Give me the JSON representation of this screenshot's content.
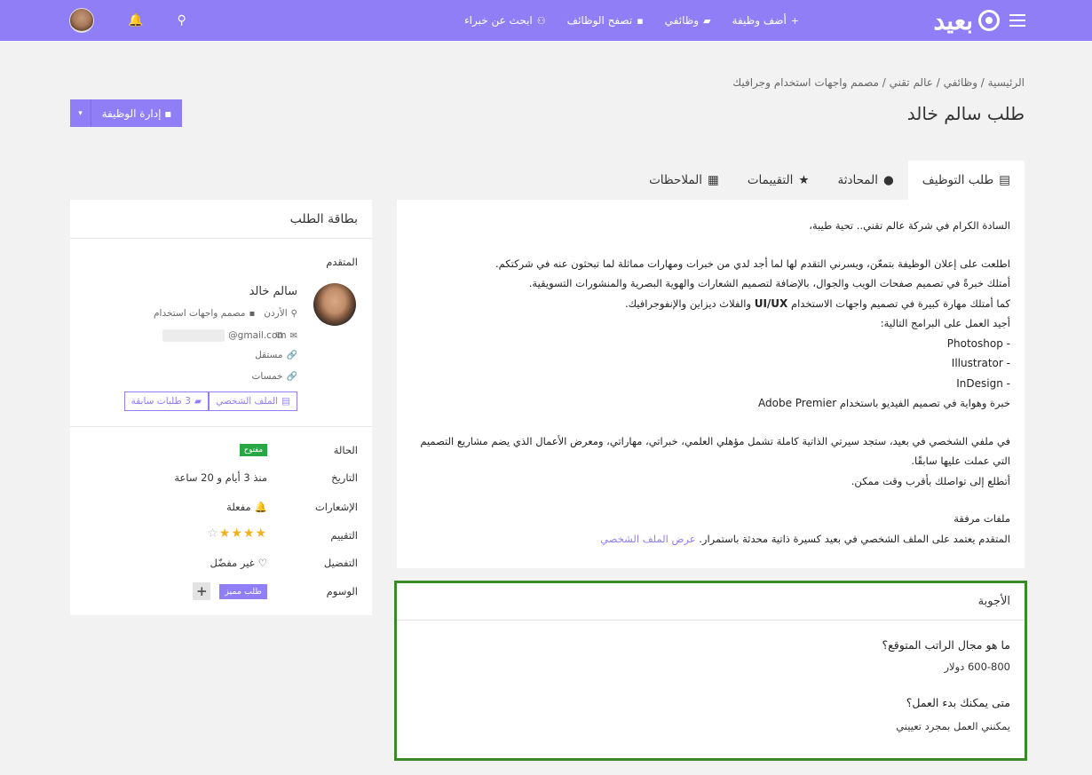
{
  "nav": {
    "logo": "بعيد",
    "links": [
      {
        "icon": "+",
        "label": "أضف وظيفة"
      },
      {
        "icon": "▰",
        "label": "وظائفي"
      },
      {
        "icon": "▪",
        "label": "تصفح الوظائف"
      },
      {
        "icon": "⚇",
        "label": "ابحث عن خبراء"
      }
    ]
  },
  "breadcrumb": "الرئيسية / وظائفي / عالم تقني / مصمم واجهات استخدام وجرافيك",
  "page_title": "طلب سالم خالد",
  "manage_button": "إدارة الوظيفة",
  "tabs": [
    {
      "label": "طلب التوظيف",
      "icon": "▤"
    },
    {
      "label": "المحادثة",
      "icon": "●"
    },
    {
      "label": "التقييمات",
      "icon": "★"
    },
    {
      "label": "الملاحظات",
      "icon": "▦"
    }
  ],
  "letter": {
    "greeting": "السادة الكرام في شركة عالم تقني.. تحية طيبة،",
    "p1": "اطلعت على إعلان الوظيفة بتمعّن، ويسرني التقدم لها لما أجد لدي من خبرات ومهارات مماثلة لما تبحثون عنه في شركتكم.",
    "p2": "أمتلك خبرةً في تصميم صفحات الويب والجوال، بالإضافة لتصميم الشعارات والهوية البصرية والمنشورات التسويقية.",
    "p3_a": "كما أمتلك مهارة كبيرة في تصميم واجهات الاستخدام",
    "p3_b": "UI/UX",
    "p3_c": "والفلاث ديزاين والإنفوجرافيك.",
    "p4": "أجيد العمل على البرامج التالية:",
    "prog1": "- Photoshop",
    "prog2": "- Illustrator",
    "prog3": "- InDesign",
    "p5_a": "خبرة وهواية في تصميم الفيديو باستخدام",
    "p5_b": "Adobe Premier",
    "p6": "في ملفي الشخصي في بعيد، ستجد سيرتي الذاتية كاملة تشمل مؤهلي العلمي، خبراتي، مهاراتي، ومعرض الأعمال الذي يضم مشاريع التصميم التي عملت عليها سابقًا.",
    "p7": "أتطلع إلى تواصلك بأقرب وقت ممكن.",
    "attachments_title": "ملفات مرفقة",
    "attachments_text": "المتقدم يعتمد على الملف الشخصي في بعيد كسيرة ذاتية محدثة باستمرار.",
    "profile_link": "عرض الملف الشخصي"
  },
  "answers": {
    "title": "الأجوبة",
    "items": [
      {
        "q": "ما هو مجال الراتب المتوقع؟",
        "a": "600-800 دولار"
      },
      {
        "q": "متى يمكنك بدء العمل؟",
        "a": "يمكنني العمل بمجرد تعييني"
      }
    ]
  },
  "card": {
    "title": "بطاقة الطلب",
    "applicant_label": "المتقدم",
    "name": "سالم خالد",
    "country": "الأردن",
    "job_title": "مصمم واجهات استخدام",
    "email_suffix": "@gmail.com",
    "work_type": "مستقل",
    "level": "خمسات",
    "profile_btn": "الملف الشخصي",
    "previous_btn": "3 طلبات سابقة",
    "rows": {
      "status_label": "الحالة",
      "status_value": "مفتوح",
      "date_label": "التاريخ",
      "date_value": "منذ 3 أيام و 20 ساعة",
      "notif_label": "الإشعارات",
      "notif_value": "مفعلة",
      "rating_label": "التقييم",
      "rating_value": 4,
      "rating_max": 5,
      "fav_label": "التفضيل",
      "fav_value": "غير مفضّل",
      "tags_label": "الوسوم",
      "tag": "طلب مميز",
      "add_tag": "+"
    }
  },
  "colors": {
    "brand": "#8f7ef5",
    "answers_border": "#3a8a2a",
    "status_green": "#28a745",
    "star": "#f2b01e"
  }
}
